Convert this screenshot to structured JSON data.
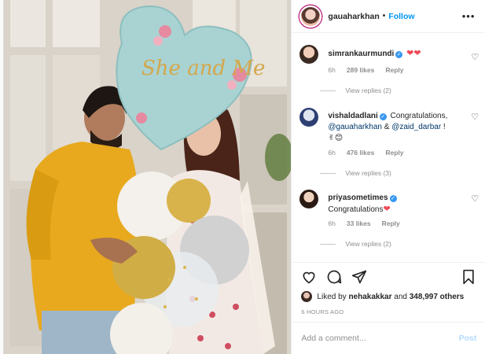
{
  "post": {
    "username": "gauaharkhan",
    "separator": "•",
    "follow_label": "Follow",
    "more_icon": "more-horizontal-icon",
    "image_balloon_text": "She and Me"
  },
  "comments": [
    {
      "username": "simrankaurmundi",
      "text": "",
      "hearts": "❤❤",
      "time": "6h",
      "likes": "289 likes",
      "reply_label": "Reply",
      "view_replies": "View replies (2)"
    },
    {
      "username": "vishaldadlani",
      "text": "Congratulations,",
      "mention1": "@gauaharkhan",
      "amp": " & ",
      "mention2": "@zaid_darbar",
      "end": " !",
      "emoji": "✌😊",
      "time": "6h",
      "likes": "476 likes",
      "reply_label": "Reply",
      "view_replies": "View replies (3)"
    },
    {
      "username": "priyasometimes",
      "text": "Congratulations",
      "hearts": "❤",
      "time": "6h",
      "likes": "33 likes",
      "reply_label": "Reply",
      "view_replies": "View replies (2)"
    }
  ],
  "actions": {
    "liked_by_prefix": "Liked by",
    "liked_by_user": "nehakakkar",
    "liked_by_and": "and",
    "liked_by_others": "348,997 others",
    "timestamp": "6 HOURS AGO"
  },
  "comment_box": {
    "placeholder": "Add a comment...",
    "post_label": "Post"
  },
  "colors": {
    "accent": "#0095f6",
    "heart": "#ed4956",
    "muted": "#8e8e8e"
  }
}
